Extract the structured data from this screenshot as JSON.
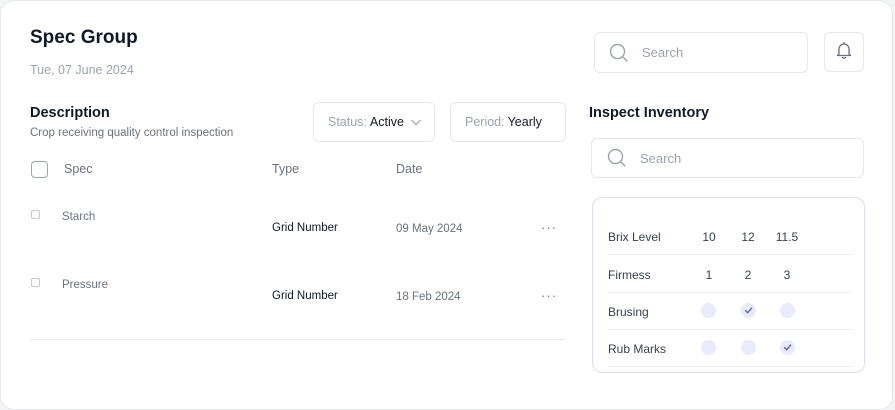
{
  "header": {
    "title": "Spec Group",
    "date": "Tue, 07 June 2024",
    "search_placeholder": "Search"
  },
  "description": {
    "title": "Description",
    "subtitle": "Crop receiving quality control inspection"
  },
  "filters": {
    "status_label": "Status:",
    "status_value": "Active",
    "period_label": "Period:",
    "period_value": "Yearly"
  },
  "table": {
    "columns": [
      "Spec",
      "Type",
      "Date"
    ],
    "rows": [
      {
        "spec": "Starch",
        "type": "Grid Number",
        "date": "09 May 2024",
        "more": "···"
      },
      {
        "spec": "Pressure",
        "type": "Grid Number",
        "date": "18 Feb 2024",
        "more": "···"
      }
    ]
  },
  "inventory": {
    "title": "Inspect Inventory",
    "search_placeholder": "Search",
    "rows": [
      {
        "label": "Brix Level",
        "values": [
          "10",
          "12",
          "11.5"
        ]
      },
      {
        "label": "Firmess",
        "values": [
          "1",
          "2",
          "3"
        ]
      },
      {
        "label": "Brusing",
        "checks": [
          false,
          true,
          false
        ]
      },
      {
        "label": "Rub Marks",
        "checks": [
          false,
          false,
          true
        ]
      }
    ]
  },
  "colors": {
    "accent": "#5b5bd6",
    "dot_fill": "#e9eafb",
    "border": "#e5e7eb"
  }
}
